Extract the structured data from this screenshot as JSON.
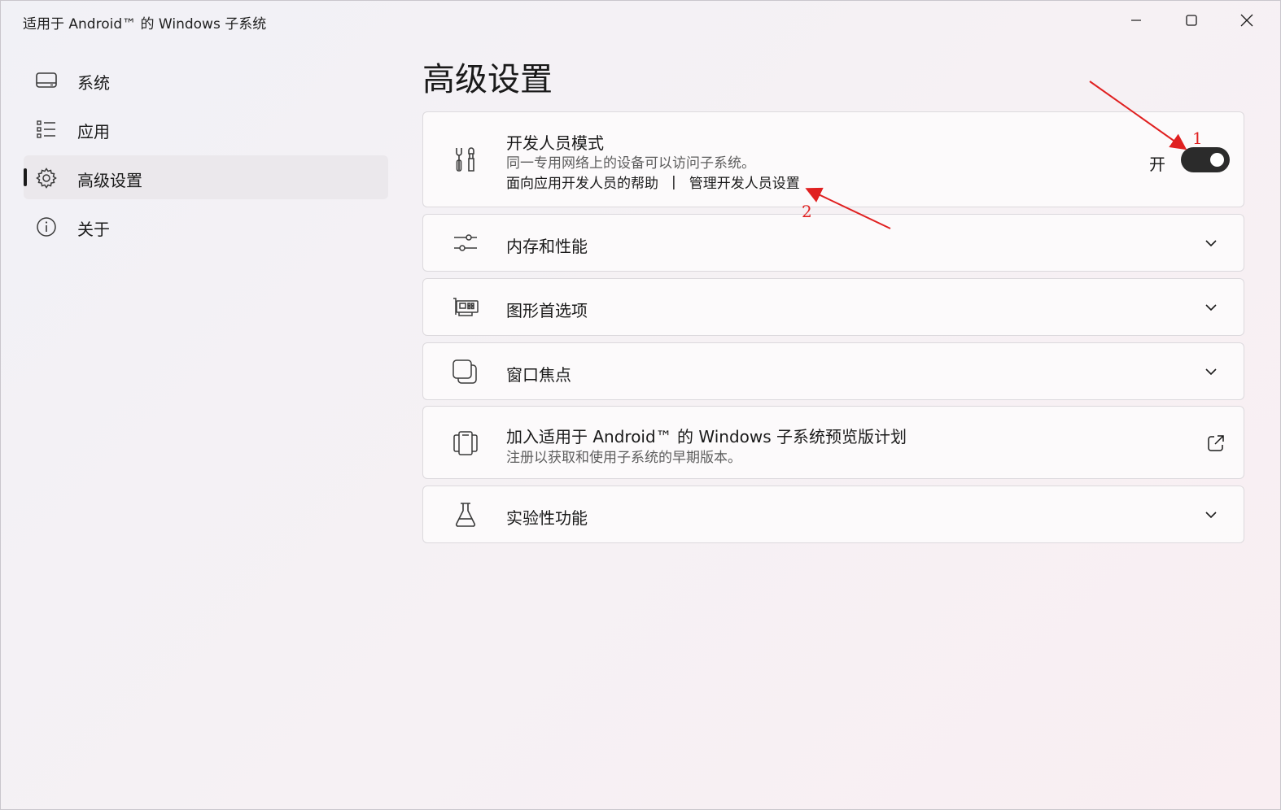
{
  "window": {
    "title": "适用于 Android™ 的 Windows 子系统"
  },
  "sidebar": {
    "items": [
      {
        "label": "系统",
        "icon": "monitor-icon",
        "active": false
      },
      {
        "label": "应用",
        "icon": "list-icon",
        "active": false
      },
      {
        "label": "高级设置",
        "icon": "gear-icon",
        "active": true
      },
      {
        "label": "关于",
        "icon": "info-icon",
        "active": false
      }
    ]
  },
  "main": {
    "title": "高级设置",
    "developer_mode": {
      "title": "开发人员模式",
      "description": "同一专用网络上的设备可以访问子系统。",
      "link_help": "面向应用开发人员的帮助",
      "link_separator": "|",
      "link_manage": "管理开发人员设置",
      "toggle_state_label": "开",
      "toggle_on": true,
      "icon": "tools-icon"
    },
    "memory": {
      "title": "内存和性能",
      "icon": "sliders-icon"
    },
    "graphics": {
      "title": "图形首选项",
      "icon": "gpu-icon"
    },
    "window_focus": {
      "title": "窗口焦点",
      "icon": "window-icon"
    },
    "preview": {
      "title": "加入适用于 Android™ 的 Windows 子系统预览版计划",
      "description": "注册以获取和使用子系统的早期版本。",
      "icon": "preview-icon",
      "action_icon": "external-link-icon"
    },
    "experimental": {
      "title": "实验性功能",
      "icon": "flask-icon"
    }
  },
  "annotations": {
    "label_1": "1",
    "label_2": "2",
    "color": "#e02020"
  }
}
